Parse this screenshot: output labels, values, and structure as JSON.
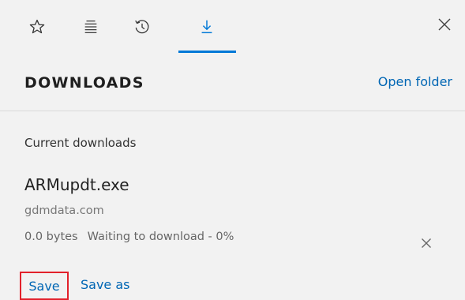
{
  "tabs": [
    {
      "icon": "star-icon",
      "label": "Favorites"
    },
    {
      "icon": "reading-list-icon",
      "label": "Reading list"
    },
    {
      "icon": "history-icon",
      "label": "History"
    },
    {
      "icon": "download-icon",
      "label": "Downloads",
      "active": true
    }
  ],
  "header": {
    "title": "DOWNLOADS",
    "open_folder_label": "Open folder"
  },
  "section": {
    "heading": "Current downloads"
  },
  "download": {
    "file_name": "ARMupdt.exe",
    "source": "gdmdata.com",
    "size": "0.0 bytes",
    "status": "Waiting to download - 0%",
    "progress_percent": 0
  },
  "actions": {
    "save_label": "Save",
    "save_as_label": "Save as"
  },
  "colors": {
    "accent": "#0078d7",
    "link": "#0066b4",
    "highlight_border": "#e2212b",
    "panel_bg": "#f2f2f2"
  }
}
